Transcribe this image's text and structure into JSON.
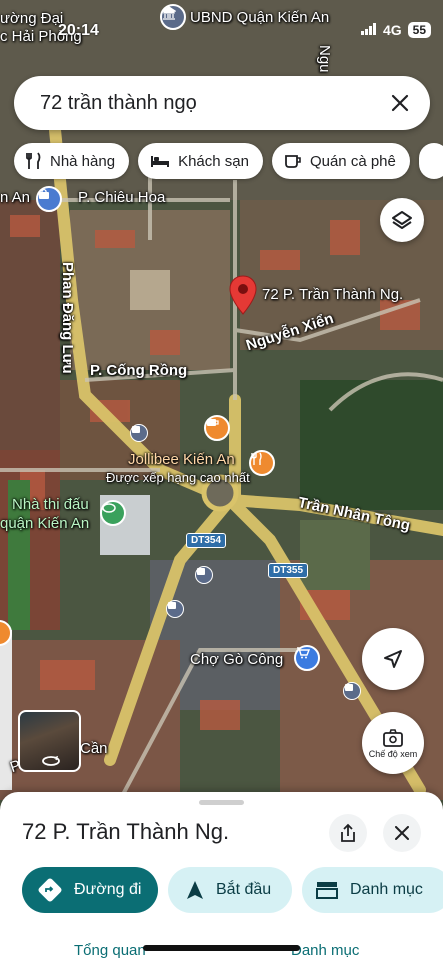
{
  "status_bar": {
    "time": "20:14",
    "network": "4G",
    "battery": "55"
  },
  "search": {
    "query": "72 trần thành ngọ"
  },
  "chips": [
    {
      "label": "Nhà hàng",
      "icon": "fork-knife-icon"
    },
    {
      "label": "Khách sạn",
      "icon": "bed-icon"
    },
    {
      "label": "Quán cà phê",
      "icon": "coffee-cup-icon"
    }
  ],
  "map": {
    "pin_label": "72 P. Trần Thành Ng.",
    "labels": {
      "top_left_1": "ường Đại",
      "top_left_2": "c Hải Phòng",
      "ubnd": "UBND Quận Kiến An",
      "nga": "Ngu",
      "an": "n An",
      "chieu_hoa": "P. Chiêu Hoa",
      "phan_dang_luu": "Phan Đăng Lưu",
      "nguyen_xien": "Nguyễn Xiển",
      "cong_rong": "P. Cống Rồng",
      "jollibee": "Jollibee Kiến An",
      "jollibee_sub": "Được xếp hạng cao nhất",
      "nha_thi_dau_1": "Nhà thi đấu",
      "nha_thi_dau_2": "quận Kiến An",
      "tran_nhan_tong": "Trần Nhân Tông",
      "dt354": "DT354",
      "dt355": "DT355",
      "cho_go_cong": "Chợ Gò Công",
      "can": "Cần",
      "p_le": "P. Le"
    },
    "view_mode_label": "Chế độ xem"
  },
  "sheet": {
    "title": "72 P. Trần Thành Ng.",
    "actions": {
      "directions": "Đường đi",
      "start": "Bắt đầu",
      "list": "Danh mục"
    },
    "tabs": {
      "overview": "Tổng quan",
      "list": "Danh mục"
    }
  },
  "colors": {
    "accent": "#0b6e74",
    "pin": "#e53935",
    "chip_light": "#d6f1f4"
  }
}
